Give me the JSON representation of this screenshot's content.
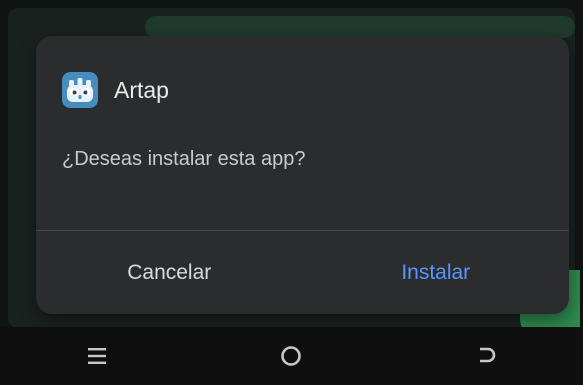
{
  "dialog": {
    "app_name": "Artap",
    "message": "¿Deseas instalar esta app?",
    "cancel_label": "Cancelar",
    "install_label": "Instalar"
  },
  "icons": {
    "app_icon": "godot-icon",
    "recents": "recents-icon",
    "home": "home-icon",
    "back": "back-icon"
  },
  "colors": {
    "dialog_background": "#2a2c2e",
    "accent": "#5b95ff",
    "text_primary": "#e9eaec",
    "text_secondary": "#c9cbcf"
  }
}
